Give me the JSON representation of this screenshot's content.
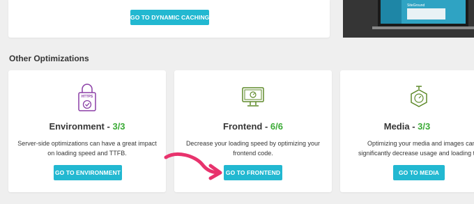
{
  "top": {
    "button_label": "GO TO DYNAMIC CACHING"
  },
  "promo": {
    "logo_text": "SiteGround"
  },
  "section": {
    "title": "Other Optimizations"
  },
  "cards": [
    {
      "title": "Environment",
      "separator": " - ",
      "score": "3/3",
      "icon_text": "HTTPS",
      "description_lines": [
        "Server-side optimizations can have a great impact",
        "on loading speed and TTFB."
      ],
      "button_label": "GO TO ENVIRONMENT"
    },
    {
      "title": "Frontend",
      "separator": " - ",
      "score": "6/6",
      "description_lines": [
        "Decrease your loading speed by optimizing your",
        "frontend code."
      ],
      "button_label": "GO TO FRONTEND"
    },
    {
      "title": "Media",
      "separator": " - ",
      "score": "3/3",
      "description_lines": [
        "Optimizing your media and images can",
        "significantly decrease usage and loading tim"
      ],
      "button_label": "GO TO MEDIA"
    }
  ],
  "colors": {
    "accent_button": "#22b8d1",
    "score_green": "#3aaa35",
    "environment_icon": "#8b3fa6",
    "frontend_icon": "#5e8a2a",
    "media_icon": "#5e8a2a",
    "annotation_arrow": "#e8336d"
  }
}
